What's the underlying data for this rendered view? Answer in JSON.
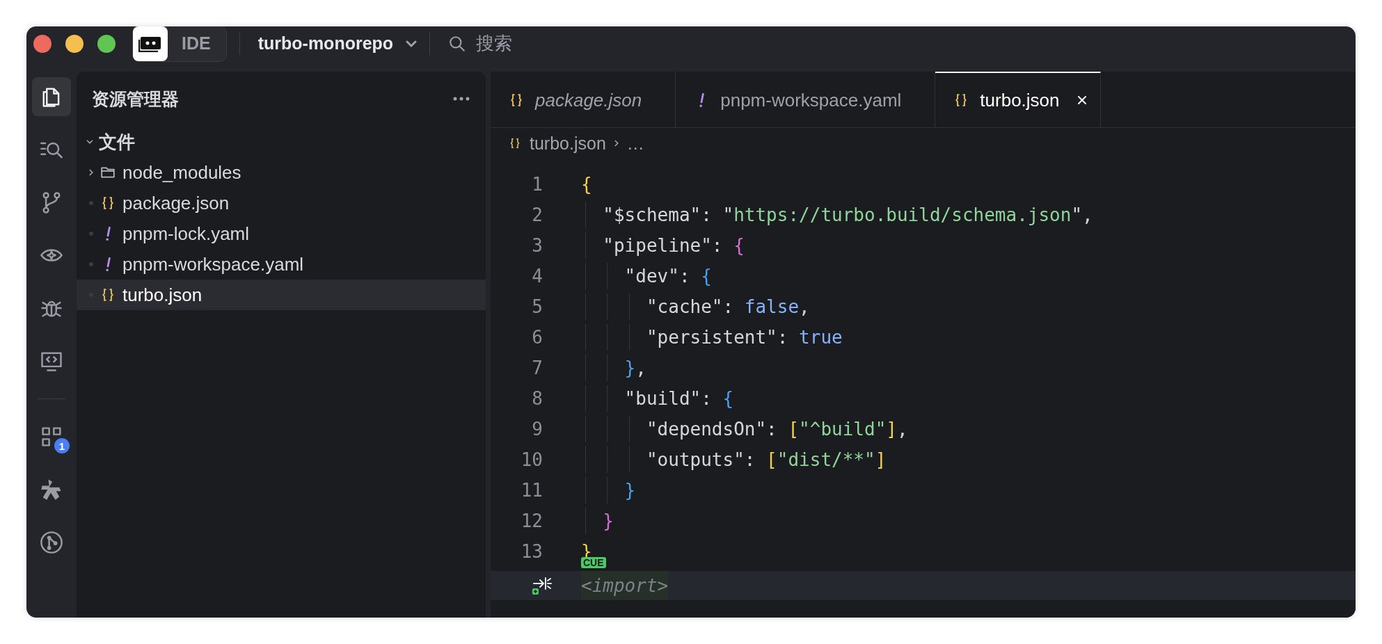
{
  "title_bar": {
    "traffic_lights": [
      {
        "color": "#ec6a5e"
      },
      {
        "color": "#f4bf4f"
      },
      {
        "color": "#61c554"
      }
    ],
    "app_label": "IDE",
    "project": "turbo-monorepo",
    "search": {
      "placeholder": "搜索"
    }
  },
  "activity_bar": {
    "top": [
      {
        "kind": "files",
        "selected": true
      },
      {
        "kind": "search",
        "selected": false
      },
      {
        "kind": "branch",
        "selected": false
      },
      {
        "kind": "eye",
        "selected": false
      },
      {
        "kind": "bug",
        "selected": false
      },
      {
        "kind": "monitor",
        "selected": false
      }
    ],
    "bottom": [
      {
        "kind": "grid",
        "selected": false,
        "badge": "1"
      },
      {
        "kind": "star",
        "selected": false
      },
      {
        "kind": "git",
        "selected": false
      }
    ]
  },
  "explorer": {
    "title": "资源管理器",
    "section": {
      "label": "文件",
      "expanded": true
    },
    "items": [
      {
        "label": "node_modules",
        "kind": "folder",
        "expanded": false,
        "selected": false
      },
      {
        "label": "package.json",
        "kind": "json",
        "selected": false
      },
      {
        "label": "pnpm-lock.yaml",
        "kind": "yaml",
        "selected": false
      },
      {
        "label": "pnpm-workspace.yaml",
        "kind": "yaml",
        "selected": false
      },
      {
        "label": "turbo.json",
        "kind": "json",
        "selected": true
      }
    ]
  },
  "tabs": [
    {
      "label": "package.json",
      "kind": "json",
      "preview": true,
      "selected": false
    },
    {
      "label": "pnpm-workspace.yaml",
      "kind": "yaml",
      "preview": false,
      "selected": false
    },
    {
      "label": "turbo.json",
      "kind": "json",
      "preview": false,
      "selected": true
    }
  ],
  "breadcrumb": {
    "file": "turbo.json",
    "kind": "json",
    "more": "…"
  },
  "code": {
    "lines": [
      {
        "number": "1",
        "tokens": [
          {
            "text": "{",
            "kind": "brace1"
          }
        ]
      },
      {
        "number": "2",
        "tokens": [
          {
            "text": "  \"$schema\": \"",
            "kind": "key"
          },
          {
            "text": "https://turbo.build/schema.json",
            "kind": "link"
          },
          {
            "text": "\",",
            "kind": "key"
          }
        ]
      },
      {
        "number": "3",
        "tokens": [
          {
            "text": "  \"pipeline\": ",
            "kind": "key"
          },
          {
            "text": "{",
            "kind": "brace2"
          }
        ]
      },
      {
        "number": "4",
        "tokens": [
          {
            "text": "    \"dev\": ",
            "kind": "key"
          },
          {
            "text": "{",
            "kind": "brace3"
          }
        ]
      },
      {
        "number": "5",
        "tokens": [
          {
            "text": "      \"cache\": ",
            "kind": "key"
          },
          {
            "text": "false",
            "kind": "bool"
          },
          {
            "text": ",",
            "kind": "key"
          }
        ]
      },
      {
        "number": "6",
        "tokens": [
          {
            "text": "      \"persistent\": ",
            "kind": "key"
          },
          {
            "text": "true",
            "kind": "bool"
          }
        ]
      },
      {
        "number": "7",
        "tokens": [
          {
            "text": "    }",
            "kind": "brace3"
          },
          {
            "text": ",",
            "kind": "key"
          }
        ]
      },
      {
        "number": "8",
        "tokens": [
          {
            "text": "    \"build\": ",
            "kind": "key"
          },
          {
            "text": "{",
            "kind": "brace3"
          }
        ]
      },
      {
        "number": "9",
        "tokens": [
          {
            "text": "      \"dependsOn\": ",
            "kind": "key"
          },
          {
            "text": "[",
            "kind": "brace1"
          },
          {
            "text": "\"^build\"",
            "kind": "string"
          },
          {
            "text": "]",
            "kind": "brace1"
          },
          {
            "text": ",",
            "kind": "key"
          }
        ]
      },
      {
        "number": "10",
        "tokens": [
          {
            "text": "      \"outputs\": ",
            "kind": "key"
          },
          {
            "text": "[",
            "kind": "brace1"
          },
          {
            "text": "\"dist/**\"",
            "kind": "string"
          },
          {
            "text": "]",
            "kind": "brace1"
          }
        ]
      },
      {
        "number": "11",
        "tokens": [
          {
            "text": "    }",
            "kind": "brace3"
          }
        ]
      },
      {
        "number": "12",
        "tokens": [
          {
            "text": "  }",
            "kind": "brace2"
          }
        ]
      },
      {
        "number": "13",
        "tokens": [
          {
            "text": "}",
            "kind": "brace1"
          }
        ],
        "badge": "CUE"
      }
    ],
    "suggestion": {
      "text": "<import>"
    }
  }
}
